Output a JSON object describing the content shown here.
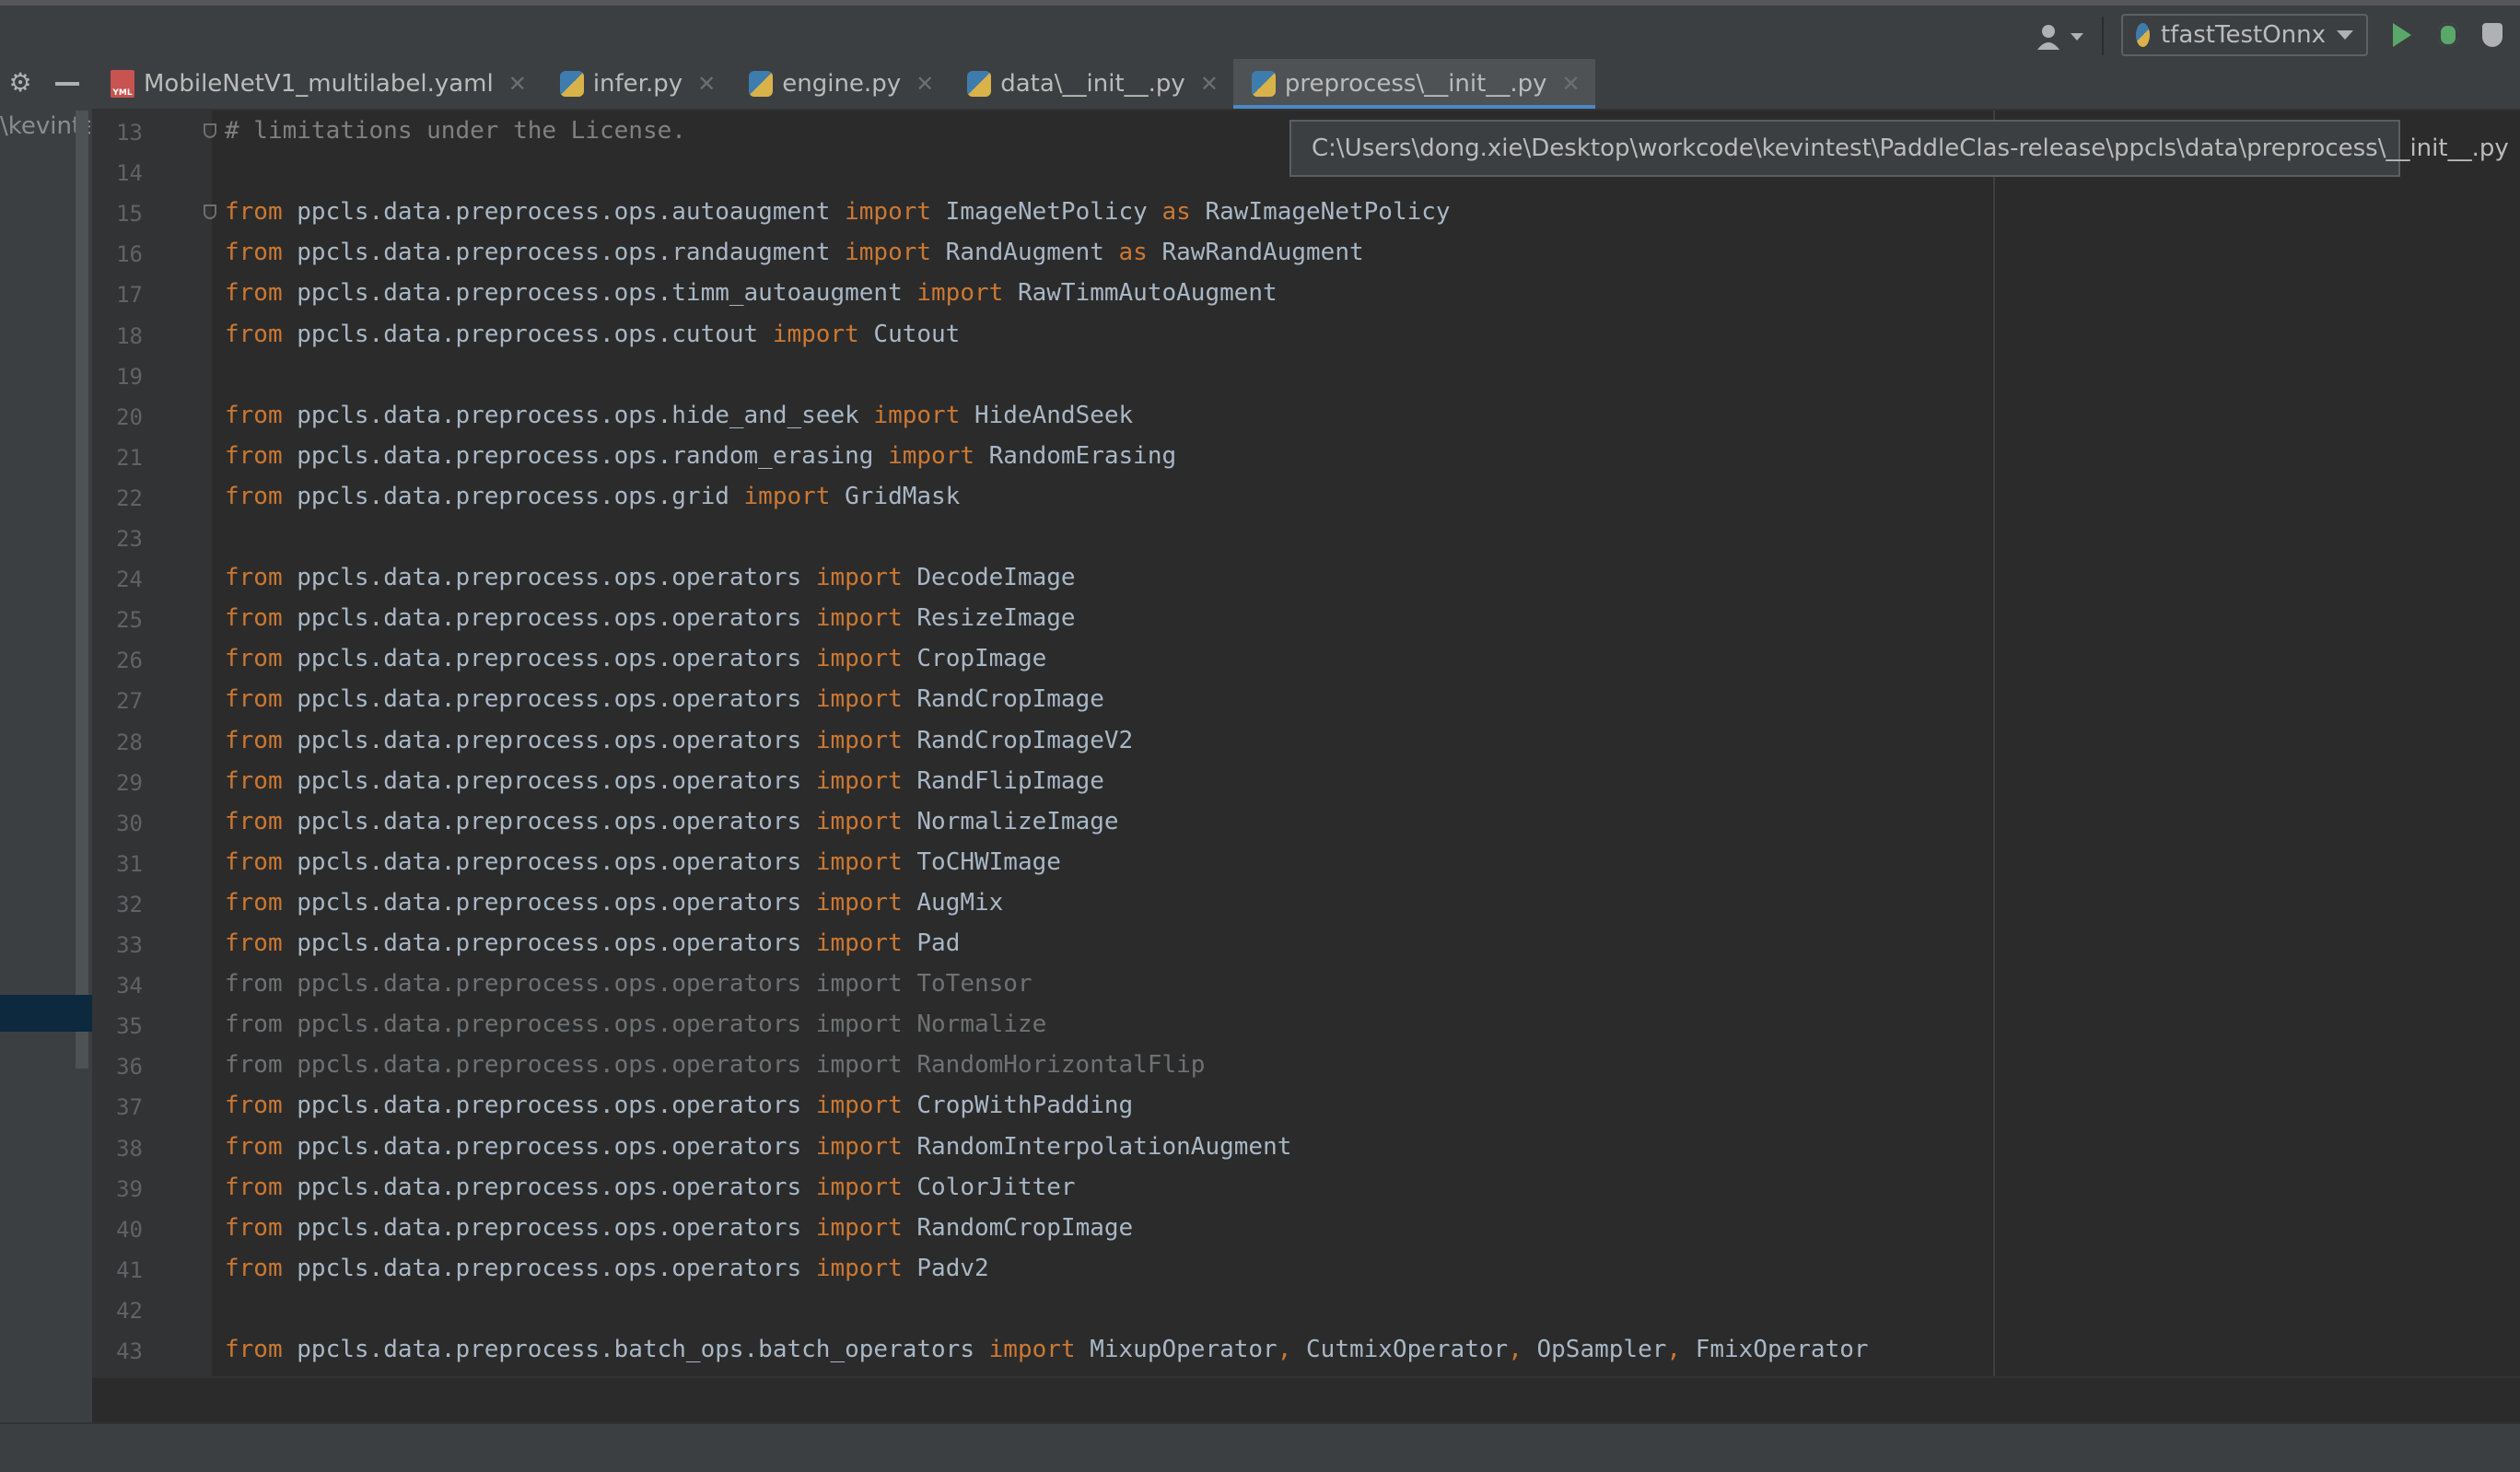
{
  "toolbar": {
    "run_config": "tfastTestOnnx",
    "user_icon": "user-icon",
    "run_icon": "run-icon",
    "debug_icon": "debug-icon",
    "coverage_icon": "coverage-icon"
  },
  "project_panel": {
    "path_fragment": "\\kevintes",
    "gear_icon": "gear-icon",
    "minimize_icon": "minimize-icon"
  },
  "tabs": [
    {
      "label": "MobileNetV1_multilabel.yaml",
      "icon": "yaml-file-icon",
      "active": false
    },
    {
      "label": "infer.py",
      "icon": "python-file-icon",
      "active": false
    },
    {
      "label": "engine.py",
      "icon": "python-file-icon",
      "active": false
    },
    {
      "label": "data\\__init__.py",
      "icon": "python-file-icon",
      "active": false
    },
    {
      "label": "preprocess\\__init__.py",
      "icon": "python-file-icon",
      "active": true
    }
  ],
  "tooltip": "C:\\Users\\dong.xie\\Desktop\\workcode\\kevintest\\PaddleClas-release\\ppcls\\data\\preprocess\\__init__.py",
  "colors": {
    "keyword": "#cc7832",
    "text": "#a9b7c6",
    "comment": "#808080",
    "unused": "#6e7275",
    "line_number": "#606366"
  },
  "code": [
    {
      "n": "13",
      "parts": [
        {
          "t": "# limitations under the License.",
          "c": "cm"
        }
      ]
    },
    {
      "n": "14",
      "parts": []
    },
    {
      "n": "15",
      "parts": [
        {
          "t": "from",
          "c": "kw"
        },
        {
          "t": " ppcls.data.preprocess.ops.autoaugment ",
          "c": ""
        },
        {
          "t": "import",
          "c": "kw"
        },
        {
          "t": " ImageNetPolicy ",
          "c": ""
        },
        {
          "t": "as",
          "c": "kw"
        },
        {
          "t": " RawImageNetPolicy",
          "c": ""
        }
      ]
    },
    {
      "n": "16",
      "parts": [
        {
          "t": "from",
          "c": "kw"
        },
        {
          "t": " ppcls.data.preprocess.ops.randaugment ",
          "c": ""
        },
        {
          "t": "import",
          "c": "kw"
        },
        {
          "t": " RandAugment ",
          "c": ""
        },
        {
          "t": "as",
          "c": "kw"
        },
        {
          "t": " RawRandAugment",
          "c": ""
        }
      ]
    },
    {
      "n": "17",
      "parts": [
        {
          "t": "from",
          "c": "kw"
        },
        {
          "t": " ppcls.data.preprocess.ops.timm_autoaugment ",
          "c": ""
        },
        {
          "t": "import",
          "c": "kw"
        },
        {
          "t": " RawTimmAutoAugment",
          "c": ""
        }
      ]
    },
    {
      "n": "18",
      "parts": [
        {
          "t": "from",
          "c": "kw"
        },
        {
          "t": " ppcls.data.preprocess.ops.cutout ",
          "c": ""
        },
        {
          "t": "import",
          "c": "kw"
        },
        {
          "t": " Cutout",
          "c": ""
        }
      ]
    },
    {
      "n": "19",
      "parts": []
    },
    {
      "n": "20",
      "parts": [
        {
          "t": "from",
          "c": "kw"
        },
        {
          "t": " ppcls.data.preprocess.ops.hide_and_seek ",
          "c": ""
        },
        {
          "t": "import",
          "c": "kw"
        },
        {
          "t": " HideAndSeek",
          "c": ""
        }
      ]
    },
    {
      "n": "21",
      "parts": [
        {
          "t": "from",
          "c": "kw"
        },
        {
          "t": " ppcls.data.preprocess.ops.random_erasing ",
          "c": ""
        },
        {
          "t": "import",
          "c": "kw"
        },
        {
          "t": " RandomErasing",
          "c": ""
        }
      ]
    },
    {
      "n": "22",
      "parts": [
        {
          "t": "from",
          "c": "kw"
        },
        {
          "t": " ppcls.data.preprocess.ops.grid ",
          "c": ""
        },
        {
          "t": "import",
          "c": "kw"
        },
        {
          "t": " GridMask",
          "c": ""
        }
      ]
    },
    {
      "n": "23",
      "parts": []
    },
    {
      "n": "24",
      "parts": [
        {
          "t": "from",
          "c": "kw"
        },
        {
          "t": " ppcls.data.preprocess.ops.operators ",
          "c": ""
        },
        {
          "t": "import",
          "c": "kw"
        },
        {
          "t": " DecodeImage",
          "c": ""
        }
      ]
    },
    {
      "n": "25",
      "parts": [
        {
          "t": "from",
          "c": "kw"
        },
        {
          "t": " ppcls.data.preprocess.ops.operators ",
          "c": ""
        },
        {
          "t": "import",
          "c": "kw"
        },
        {
          "t": " ResizeImage",
          "c": ""
        }
      ]
    },
    {
      "n": "26",
      "parts": [
        {
          "t": "from",
          "c": "kw"
        },
        {
          "t": " ppcls.data.preprocess.ops.operators ",
          "c": ""
        },
        {
          "t": "import",
          "c": "kw"
        },
        {
          "t": " CropImage",
          "c": ""
        }
      ]
    },
    {
      "n": "27",
      "parts": [
        {
          "t": "from",
          "c": "kw"
        },
        {
          "t": " ppcls.data.preprocess.ops.operators ",
          "c": ""
        },
        {
          "t": "import",
          "c": "kw"
        },
        {
          "t": " RandCropImage",
          "c": ""
        }
      ]
    },
    {
      "n": "28",
      "parts": [
        {
          "t": "from",
          "c": "kw"
        },
        {
          "t": " ppcls.data.preprocess.ops.operators ",
          "c": ""
        },
        {
          "t": "import",
          "c": "kw"
        },
        {
          "t": " RandCropImageV2",
          "c": ""
        }
      ]
    },
    {
      "n": "29",
      "parts": [
        {
          "t": "from",
          "c": "kw"
        },
        {
          "t": " ppcls.data.preprocess.ops.operators ",
          "c": ""
        },
        {
          "t": "import",
          "c": "kw"
        },
        {
          "t": " RandFlipImage",
          "c": ""
        }
      ]
    },
    {
      "n": "30",
      "parts": [
        {
          "t": "from",
          "c": "kw"
        },
        {
          "t": " ppcls.data.preprocess.ops.operators ",
          "c": ""
        },
        {
          "t": "import",
          "c": "kw"
        },
        {
          "t": " NormalizeImage",
          "c": ""
        }
      ]
    },
    {
      "n": "31",
      "parts": [
        {
          "t": "from",
          "c": "kw"
        },
        {
          "t": " ppcls.data.preprocess.ops.operators ",
          "c": ""
        },
        {
          "t": "import",
          "c": "kw"
        },
        {
          "t": " ToCHWImage",
          "c": ""
        }
      ]
    },
    {
      "n": "32",
      "parts": [
        {
          "t": "from",
          "c": "kw"
        },
        {
          "t": " ppcls.data.preprocess.ops.operators ",
          "c": ""
        },
        {
          "t": "import",
          "c": "kw"
        },
        {
          "t": " AugMix",
          "c": ""
        }
      ]
    },
    {
      "n": "33",
      "parts": [
        {
          "t": "from",
          "c": "kw"
        },
        {
          "t": " ppcls.data.preprocess.ops.operators ",
          "c": ""
        },
        {
          "t": "import",
          "c": "kw"
        },
        {
          "t": " Pad",
          "c": ""
        }
      ]
    },
    {
      "n": "34",
      "parts": [
        {
          "t": "from ppcls.data.preprocess.ops.operators import ToTensor",
          "c": "dim"
        }
      ]
    },
    {
      "n": "35",
      "parts": [
        {
          "t": "from ppcls.data.preprocess.ops.operators import Normalize",
          "c": "dim"
        }
      ]
    },
    {
      "n": "36",
      "parts": [
        {
          "t": "from ppcls.data.preprocess.ops.operators import RandomHorizontalFlip",
          "c": "dim"
        }
      ]
    },
    {
      "n": "37",
      "parts": [
        {
          "t": "from",
          "c": "kw"
        },
        {
          "t": " ppcls.data.preprocess.ops.operators ",
          "c": ""
        },
        {
          "t": "import",
          "c": "kw"
        },
        {
          "t": " CropWithPadding",
          "c": ""
        }
      ]
    },
    {
      "n": "38",
      "parts": [
        {
          "t": "from",
          "c": "kw"
        },
        {
          "t": " ppcls.data.preprocess.ops.operators ",
          "c": ""
        },
        {
          "t": "import",
          "c": "kw"
        },
        {
          "t": " RandomInterpolationAugment",
          "c": ""
        }
      ]
    },
    {
      "n": "39",
      "parts": [
        {
          "t": "from",
          "c": "kw"
        },
        {
          "t": " ppcls.data.preprocess.ops.operators ",
          "c": ""
        },
        {
          "t": "import",
          "c": "kw"
        },
        {
          "t": " ColorJitter",
          "c": ""
        }
      ]
    },
    {
      "n": "40",
      "parts": [
        {
          "t": "from",
          "c": "kw"
        },
        {
          "t": " ppcls.data.preprocess.ops.operators ",
          "c": ""
        },
        {
          "t": "import",
          "c": "kw"
        },
        {
          "t": " RandomCropImage",
          "c": ""
        }
      ]
    },
    {
      "n": "41",
      "parts": [
        {
          "t": "from",
          "c": "kw"
        },
        {
          "t": " ppcls.data.preprocess.ops.operators ",
          "c": ""
        },
        {
          "t": "import",
          "c": "kw"
        },
        {
          "t": " Padv2",
          "c": ""
        }
      ]
    },
    {
      "n": "42",
      "parts": []
    },
    {
      "n": "43",
      "parts": [
        {
          "t": "from",
          "c": "kw"
        },
        {
          "t": " ppcls.data.preprocess.batch_ops.batch_operators ",
          "c": ""
        },
        {
          "t": "import",
          "c": "kw"
        },
        {
          "t": " MixupOperator",
          "c": ""
        },
        {
          "t": ",",
          "c": "kw"
        },
        {
          "t": " CutmixOperator",
          "c": ""
        },
        {
          "t": ",",
          "c": "kw"
        },
        {
          "t": " OpSampler",
          "c": ""
        },
        {
          "t": ",",
          "c": "kw"
        },
        {
          "t": " FmixOperator",
          "c": ""
        }
      ]
    }
  ]
}
